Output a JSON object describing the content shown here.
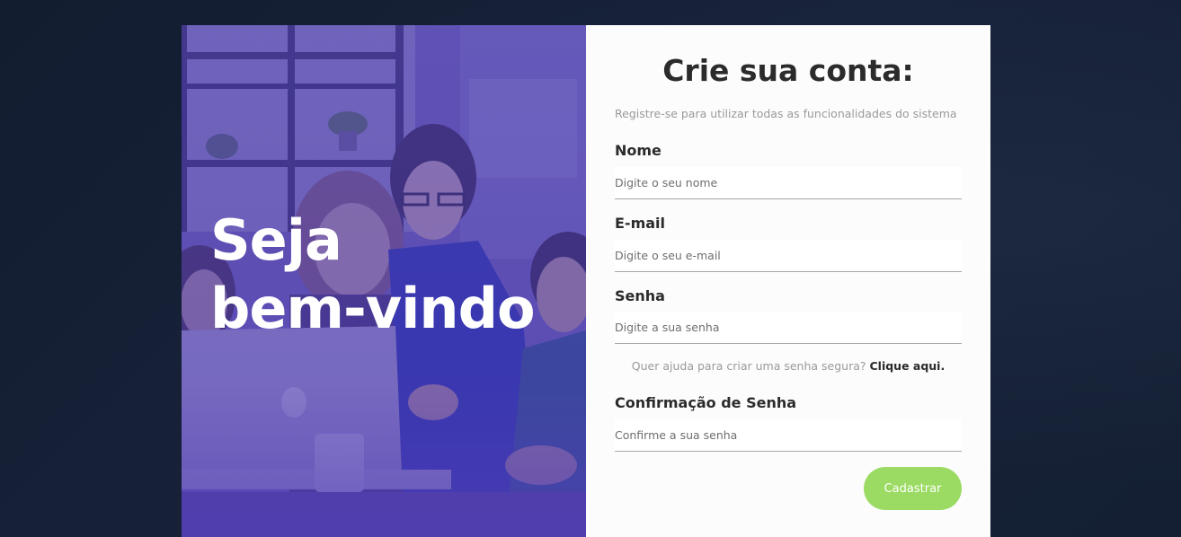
{
  "hero": {
    "title_line1": "Seja",
    "title_line2": "bem-vindo"
  },
  "form": {
    "title": "Crie sua conta:",
    "subtitle": "Registre-se para utilizar todas as funcionalidades do sistema",
    "name": {
      "label": "Nome",
      "placeholder": "Digite o seu nome",
      "value": ""
    },
    "email": {
      "label": "E-mail",
      "placeholder": "Digite o seu e-mail",
      "value": ""
    },
    "password": {
      "label": "Senha",
      "placeholder": "Digite a sua senha",
      "value": ""
    },
    "password_help": {
      "text": "Quer ajuda para criar uma senha segura?",
      "link": "Clique aqui."
    },
    "confirm": {
      "label": "Confirmação de Senha",
      "placeholder": "Confirme a sua senha",
      "value": ""
    },
    "submit_label": "Cadastrar"
  },
  "colors": {
    "page_background": "#141f33",
    "hero_overlay": "#5547a6",
    "form_background": "#fcfcfc",
    "submit_button": "#9bdb63",
    "text_dark": "#2b2b2b",
    "text_muted": "#9a9a9a"
  }
}
